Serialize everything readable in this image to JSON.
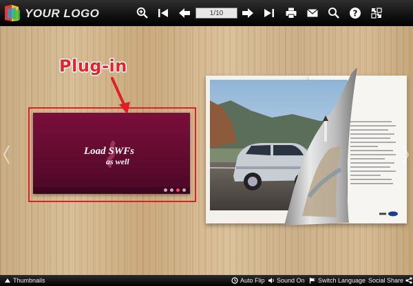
{
  "header": {
    "logo_text": "YOUR LOGO",
    "page_indicator": "1/10",
    "icons": [
      "zoom-in-icon",
      "first-page-icon",
      "prev-page-icon",
      "next-page-icon",
      "last-page-icon",
      "print-icon",
      "email-icon",
      "search-icon",
      "help-icon",
      "fullscreen-icon"
    ]
  },
  "annotation": {
    "label": "Plug-in",
    "color": "#e01e25"
  },
  "plugin": {
    "line1": "Load SWFs",
    "line2": "as well",
    "bg_color": "#6b0d33",
    "dots": 4,
    "active_dot": 3
  },
  "bottom": {
    "thumbnails": "Thumbnails",
    "auto_flip": "Auto Flip",
    "sound_on": "Sound On",
    "switch_language": "Switch Language",
    "social_share": "Social Share"
  },
  "colors": {
    "toolbar_bg": "#111111",
    "wood_light": "#d8bf97",
    "wood_dark": "#c6a77c"
  }
}
